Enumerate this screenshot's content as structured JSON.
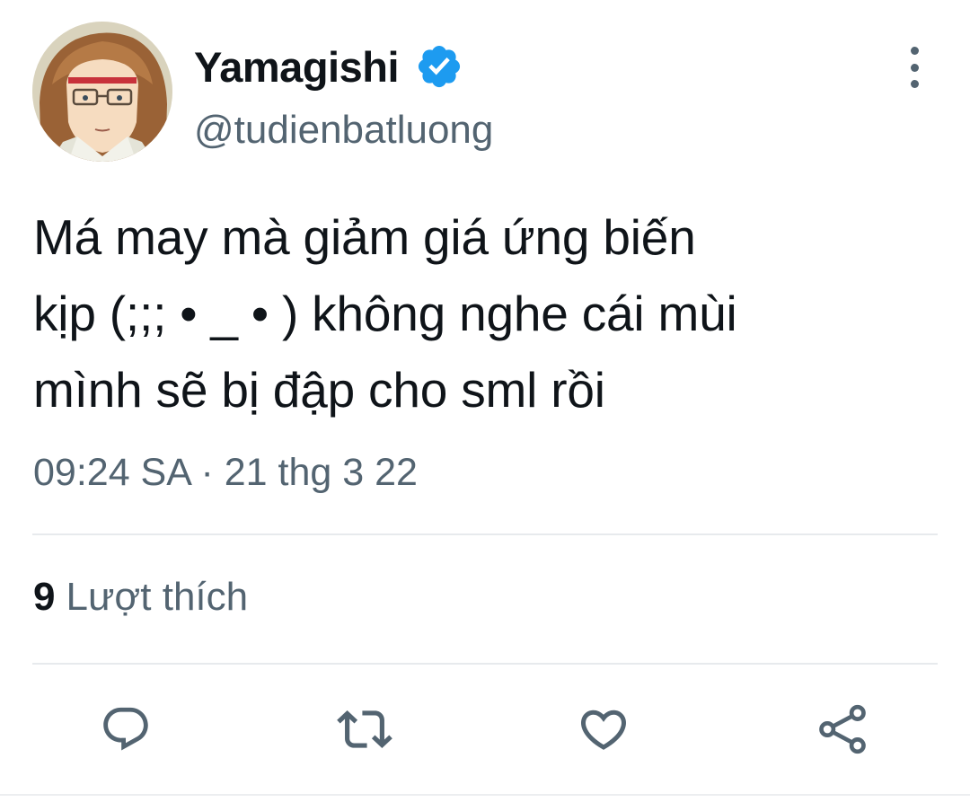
{
  "author": {
    "display_name": "Yamagishi",
    "handle": "@tudienbatluong",
    "verified": true,
    "verified_color": "#1d9bf0"
  },
  "tweet": {
    "text": "Má may mà giảm giá ứng biến\nkịp (;;; • _ • ) không nghe cái mùi\nmình sẽ bị đập cho sml rồi",
    "timestamp": "09:24 SA · 21 thg 3 22"
  },
  "stats": {
    "likes_count": "9",
    "likes_label": "Lượt thích"
  },
  "actions": [
    {
      "icon": "reply-icon"
    },
    {
      "icon": "retweet-icon"
    },
    {
      "icon": "like-icon"
    },
    {
      "icon": "share-icon"
    }
  ],
  "colors": {
    "text_primary": "#0f1419",
    "text_secondary": "#536471",
    "divider": "#e7eaed",
    "icon": "#536471"
  }
}
